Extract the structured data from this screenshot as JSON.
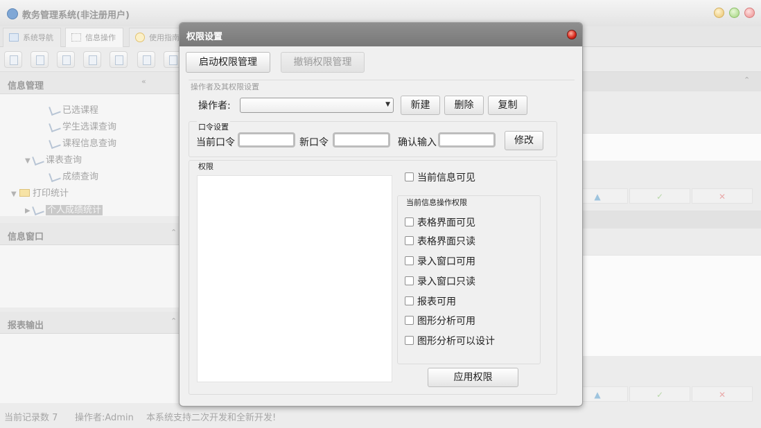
{
  "window": {
    "title": "教务管理系统(非注册用户)"
  },
  "main_tabs": [
    {
      "label": "系统导航"
    },
    {
      "label": "信息操作"
    },
    {
      "label": "使用指南"
    }
  ],
  "left_panels": {
    "info_manage": {
      "title": "信息管理"
    },
    "info_window": {
      "title": "信息窗口"
    },
    "report_output": {
      "title": "报表输出"
    }
  },
  "tree": [
    {
      "label": "已选课程"
    },
    {
      "label": "学生选课查询"
    },
    {
      "label": "课程信息查询"
    },
    {
      "label": "课表查询"
    },
    {
      "label": "成绩查询"
    },
    {
      "label": "打印统计"
    },
    {
      "label": "个人成绩统计"
    }
  ],
  "right_actions": {
    "up": "▲",
    "confirm": "✓",
    "cancel": "✕"
  },
  "statusbar": {
    "record_count": "当前记录数 7",
    "operator": "操作者:Admin",
    "notice": "本系统支持二次开发和全新开发!"
  },
  "dialog": {
    "title": "权限设置",
    "enable_button": "启动权限管理",
    "revoke_button": "撤销权限管理",
    "operator_group": {
      "label": "操作者及其权限设置",
      "operator_label": "操作者:",
      "operator_value": "",
      "new_button": "新建",
      "delete_button": "删除",
      "copy_button": "复制"
    },
    "password_group": {
      "label": "口令设置",
      "current_label": "当前口令",
      "new_label": "新口令",
      "confirm_label": "确认输入",
      "modify_button": "修改"
    },
    "permission_group": {
      "label": "权限",
      "current_visible": "当前信息可见",
      "sub_label": "当前信息操作权限",
      "options": [
        "表格界面可见",
        "表格界面只读",
        "录入窗口可用",
        "录入窗口只读",
        "报表可用",
        "图形分析可用",
        "图形分析可以设计"
      ],
      "apply_button": "应用权限"
    }
  }
}
